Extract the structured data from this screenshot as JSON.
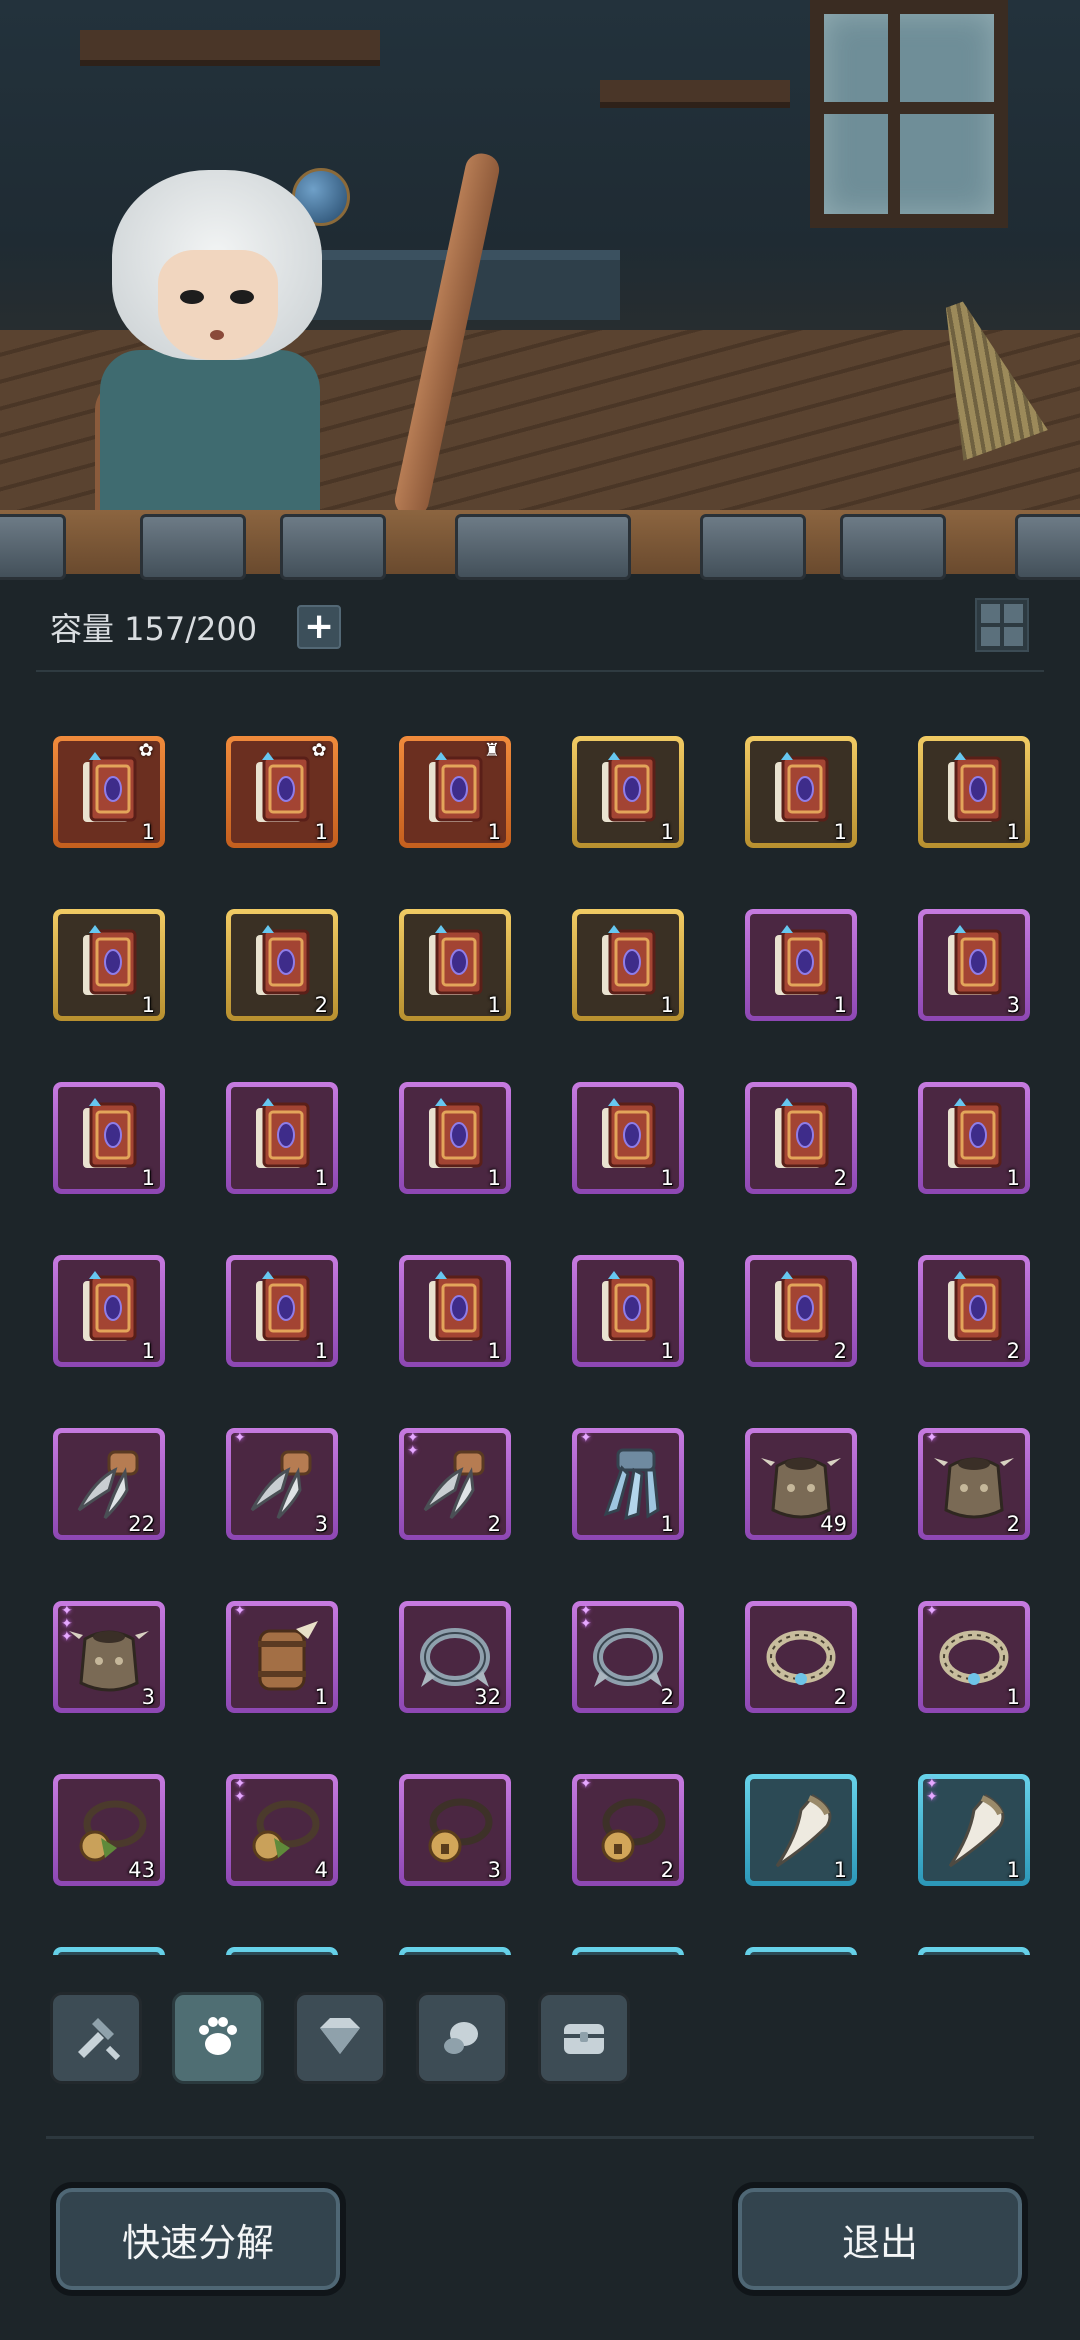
{
  "capacity": {
    "label": "容量 157/200",
    "add_icon": "plus-icon"
  },
  "view_toggle_icon": "grid-view-icon",
  "colors": {
    "orange": "#f08b3c",
    "gold": "#f1cb64",
    "purple": "#c77be0",
    "blue": "#68d3ea",
    "background": "#1d2529"
  },
  "inventory": [
    {
      "quality": "orange",
      "item": "spellbook",
      "count": "1",
      "badge": "sprout"
    },
    {
      "quality": "orange",
      "item": "spellbook",
      "count": "1",
      "badge": "sprout"
    },
    {
      "quality": "orange",
      "item": "spellbook",
      "count": "1",
      "badge": "tower"
    },
    {
      "quality": "gold",
      "item": "spellbook",
      "count": "1"
    },
    {
      "quality": "gold",
      "item": "spellbook",
      "count": "1"
    },
    {
      "quality": "gold",
      "item": "spellbook",
      "count": "1"
    },
    {
      "quality": "gold",
      "item": "spellbook",
      "count": "1"
    },
    {
      "quality": "gold",
      "item": "spellbook",
      "count": "2"
    },
    {
      "quality": "gold",
      "item": "spellbook",
      "count": "1"
    },
    {
      "quality": "gold",
      "item": "spellbook",
      "count": "1"
    },
    {
      "quality": "purple",
      "item": "spellbook",
      "count": "1"
    },
    {
      "quality": "purple",
      "item": "spellbook",
      "count": "3"
    },
    {
      "quality": "purple",
      "item": "spellbook",
      "count": "1"
    },
    {
      "quality": "purple",
      "item": "spellbook",
      "count": "1"
    },
    {
      "quality": "purple",
      "item": "spellbook",
      "count": "1"
    },
    {
      "quality": "purple",
      "item": "spellbook",
      "count": "1"
    },
    {
      "quality": "purple",
      "item": "spellbook",
      "count": "2"
    },
    {
      "quality": "purple",
      "item": "spellbook",
      "count": "1"
    },
    {
      "quality": "purple",
      "item": "spellbook",
      "count": "1"
    },
    {
      "quality": "purple",
      "item": "spellbook",
      "count": "1"
    },
    {
      "quality": "purple",
      "item": "spellbook",
      "count": "1"
    },
    {
      "quality": "purple",
      "item": "spellbook",
      "count": "1"
    },
    {
      "quality": "purple",
      "item": "spellbook",
      "count": "2"
    },
    {
      "quality": "purple",
      "item": "spellbook",
      "count": "2"
    },
    {
      "quality": "purple",
      "item": "claw",
      "count": "22",
      "stars": 0
    },
    {
      "quality": "purple",
      "item": "claw",
      "count": "3",
      "stars": 1
    },
    {
      "quality": "purple",
      "item": "claw",
      "count": "2",
      "stars": 2
    },
    {
      "quality": "purple",
      "item": "claw-blue",
      "count": "1",
      "stars": 1
    },
    {
      "quality": "purple",
      "item": "armor",
      "count": "49",
      "stars": 0
    },
    {
      "quality": "purple",
      "item": "armor",
      "count": "2",
      "stars": 1
    },
    {
      "quality": "purple",
      "item": "armor",
      "count": "3",
      "stars": 3
    },
    {
      "quality": "purple",
      "item": "barrel",
      "count": "1",
      "stars": 1
    },
    {
      "quality": "purple",
      "item": "collar",
      "count": "32",
      "stars": 0
    },
    {
      "quality": "purple",
      "item": "collar",
      "count": "2",
      "stars": 2
    },
    {
      "quality": "purple",
      "item": "ring",
      "count": "2",
      "stars": 0
    },
    {
      "quality": "purple",
      "item": "ring",
      "count": "1",
      "stars": 1
    },
    {
      "quality": "purple",
      "item": "bell-collar",
      "count": "43",
      "stars": 0
    },
    {
      "quality": "purple",
      "item": "bell-collar",
      "count": "4",
      "stars": 2
    },
    {
      "quality": "purple",
      "item": "bell",
      "count": "3",
      "stars": 0
    },
    {
      "quality": "purple",
      "item": "bell",
      "count": "2",
      "stars": 1
    },
    {
      "quality": "blue",
      "item": "fang",
      "count": "1",
      "stars": 0
    },
    {
      "quality": "blue",
      "item": "fang",
      "count": "1",
      "stars": 2
    },
    {
      "quality": "blue",
      "item": "hidden",
      "count": ""
    },
    {
      "quality": "blue",
      "item": "hidden",
      "count": ""
    },
    {
      "quality": "blue",
      "item": "hidden",
      "count": ""
    },
    {
      "quality": "blue",
      "item": "hidden",
      "count": ""
    },
    {
      "quality": "blue",
      "item": "hidden",
      "count": ""
    },
    {
      "quality": "blue",
      "item": "hidden",
      "count": ""
    }
  ],
  "tabs": [
    {
      "icon": "weapon-tools-icon",
      "active": false
    },
    {
      "icon": "paw-icon",
      "active": true
    },
    {
      "icon": "gem-icon",
      "active": false
    },
    {
      "icon": "material-icon",
      "active": false
    },
    {
      "icon": "chest-icon",
      "active": false
    }
  ],
  "buttons": {
    "quick_decompose": "快速分解",
    "exit": "退出"
  }
}
